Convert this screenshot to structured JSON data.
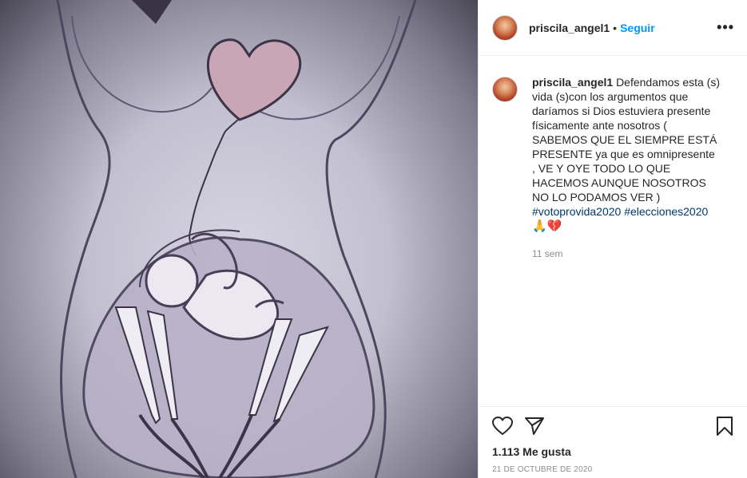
{
  "post": {
    "username": "priscila_angel1",
    "separator": "•",
    "follow_label": "Seguir",
    "more_label": "•••"
  },
  "caption": {
    "username": "priscila_angel1",
    "text": "Defendamos esta (s) vida (s)con los argumentos que daríamos si Dios estuviera presente físicamente ante nosotros ( SABEMOS QUE EL SIEMPRE ESTÁ PRESENTE ya que es omnipresente , VE Y OYE TODO LO QUE HACEMOS AUNQUE NOSOTROS NO LO PODAMOS VER )",
    "hashtags": "#votoprovida2020 #elecciones2020",
    "emojis": "🙏💔",
    "time": "11 sem"
  },
  "footer": {
    "likes": "1.113 Me gusta",
    "date": "21 DE OCTUBRE DE 2020"
  },
  "icons": {
    "like": "heart-outline-icon",
    "share": "paper-plane-icon",
    "save": "bookmark-icon",
    "more": "more-dots-icon"
  }
}
